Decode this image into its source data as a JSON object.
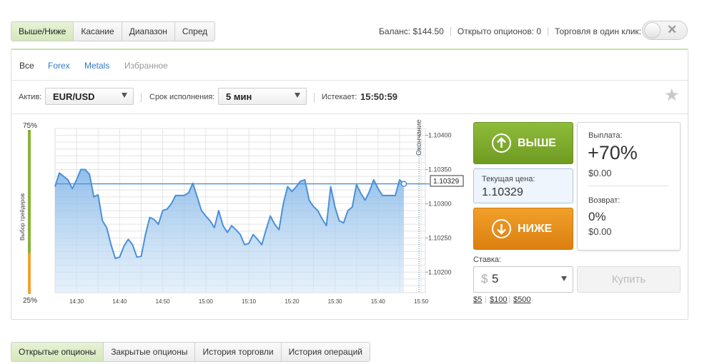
{
  "option_tabs": [
    {
      "label": "Выше/Ниже",
      "active": true
    },
    {
      "label": "Касание",
      "active": false
    },
    {
      "label": "Диапазон",
      "active": false
    },
    {
      "label": "Спред",
      "active": false
    }
  ],
  "top_info": {
    "balance_label": "Баланс:",
    "balance_value": "$144.50",
    "open_label": "Открыто опционов:",
    "open_value": "0",
    "one_click_label": "Торговля в один клик:",
    "one_click_on": false
  },
  "categories": [
    {
      "label": "Все",
      "active": true
    },
    {
      "label": "Forex",
      "active": false
    },
    {
      "label": "Metals",
      "active": false
    },
    {
      "label": "Избранное",
      "active": false
    }
  ],
  "controls": {
    "asset_label": "Актив:",
    "asset_value": "EUR/USD",
    "expiry_label": "Срок исполнения:",
    "expiry_value": "5 мин",
    "expires_label": "Истекает:",
    "expires_value": "15:50:59"
  },
  "chart_data": {
    "type": "area",
    "x": [
      "14:25",
      "14:26",
      "14:27",
      "14:28",
      "14:29",
      "14:30",
      "14:31",
      "14:32",
      "14:33",
      "14:34",
      "14:35",
      "14:36",
      "14:37",
      "14:38",
      "14:39",
      "14:40",
      "14:41",
      "14:42",
      "14:43",
      "14:44",
      "14:45",
      "14:46",
      "14:47",
      "14:48",
      "14:49",
      "14:50",
      "14:51",
      "14:52",
      "14:53",
      "14:54",
      "14:55",
      "14:56",
      "14:57",
      "14:58",
      "14:59",
      "15:00",
      "15:01",
      "15:02",
      "15:03",
      "15:04",
      "15:05",
      "15:06",
      "15:07",
      "15:08",
      "15:09",
      "15:10",
      "15:11",
      "15:12",
      "15:13",
      "15:14",
      "15:15",
      "15:16",
      "15:17",
      "15:18",
      "15:19",
      "15:20",
      "15:21",
      "15:22",
      "15:23",
      "15:24",
      "15:25",
      "15:26",
      "15:27",
      "15:28",
      "15:29",
      "15:30",
      "15:31",
      "15:32",
      "15:33",
      "15:34",
      "15:35",
      "15:36",
      "15:37",
      "15:38",
      "15:39",
      "15:40",
      "15:41",
      "15:42",
      "15:43",
      "15:44",
      "15:45",
      "15:46"
    ],
    "values": [
      1.10325,
      1.10345,
      1.1034,
      1.10335,
      1.10322,
      1.10335,
      1.1035,
      1.1035,
      1.10343,
      1.1031,
      1.10313,
      1.10275,
      1.10265,
      1.1024,
      1.1022,
      1.10222,
      1.10238,
      1.10248,
      1.1024,
      1.10222,
      1.10223,
      1.10255,
      1.1028,
      1.10277,
      1.1027,
      1.1029,
      1.10292,
      1.103,
      1.10312,
      1.10312,
      1.10312,
      1.10316,
      1.1033,
      1.1031,
      1.1029,
      1.10282,
      1.10275,
      1.10265,
      1.1029,
      1.10268,
      1.10258,
      1.10268,
      1.10262,
      1.10255,
      1.1024,
      1.10242,
      1.10255,
      1.10248,
      1.1024,
      1.10262,
      1.10282,
      1.1027,
      1.10262,
      1.103,
      1.10325,
      1.10318,
      1.10325,
      1.10333,
      1.10335,
      1.10305,
      1.10296,
      1.1029,
      1.10278,
      1.10268,
      1.10325,
      1.10295,
      1.10275,
      1.10272,
      1.1029,
      1.10295,
      1.10328,
      1.10315,
      1.10305,
      1.10318,
      1.10335,
      1.10322,
      1.10312,
      1.10312,
      1.10312,
      1.10312,
      1.10335,
      1.10329
    ],
    "x_ticks": [
      "14:30",
      "14:40",
      "14:50",
      "15:00",
      "15:10",
      "15:20",
      "15:30",
      "15:40",
      "15:50"
    ],
    "y_ticks": [
      1.104,
      1.1035,
      1.103,
      1.1025,
      1.102
    ],
    "y_tick_labels": [
      "1.10400",
      "1.10350",
      "1.10300",
      "1.10250",
      "1.10200"
    ],
    "ylim": [
      1.1017,
      1.1041
    ],
    "current_line": 1.10329,
    "current_label": "1.10329",
    "expiry_label": "Окончание",
    "grid": true
  },
  "sentiment": {
    "label": "Выбор трейдеров",
    "top_value": "75%",
    "bottom_value": "25%",
    "up_fraction": 0.75,
    "up_color": "#86b33a",
    "down_color": "#f0a035"
  },
  "trade": {
    "up_label": "ВЫШЕ",
    "down_label": "НИЖЕ",
    "current_price_label": "Текущая цена:",
    "current_price_value": "1.10329",
    "payout_label": "Выплата:",
    "payout_percent": "+70%",
    "payout_amount": "$0.00",
    "refund_label": "Возврат:",
    "refund_percent": "0%",
    "refund_amount": "$0.00",
    "stake_label": "Ставка:",
    "stake_currency": "$",
    "stake_value": "5",
    "buy_label": "Купить",
    "quick_amounts": [
      "$5",
      "$100",
      "$500"
    ]
  },
  "bottom_tabs": [
    {
      "label": "Открытые опционы",
      "active": true
    },
    {
      "label": "Закрытые опционы",
      "active": false
    },
    {
      "label": "История торговли",
      "active": false
    },
    {
      "label": "История операций",
      "active": false
    }
  ]
}
